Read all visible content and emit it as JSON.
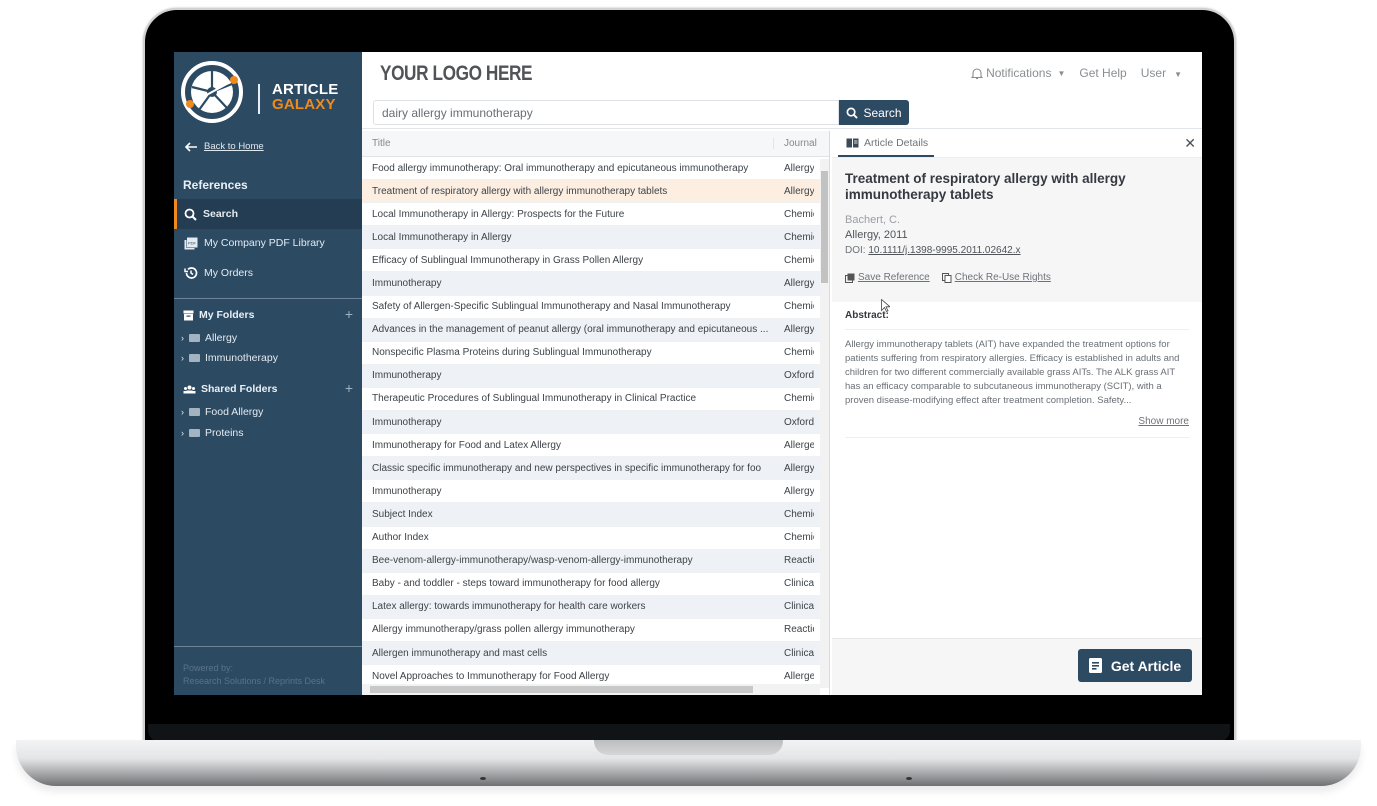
{
  "brand": {
    "line1": "ARTICLE",
    "line2": "GALAXY",
    "accent": "#f08a1c",
    "sidebar_bg": "#2d4a63"
  },
  "sidebar": {
    "back_label": "Back to Home",
    "section_title": "References",
    "nav": [
      {
        "label": "Search",
        "icon": "search-icon",
        "active": true
      },
      {
        "label": "My Company PDF Library",
        "icon": "pdf-icon",
        "active": false
      },
      {
        "label": "My Orders",
        "icon": "history-icon",
        "active": false
      }
    ],
    "my_folders": {
      "title": "My Folders",
      "items": [
        "Allergy",
        "Immunotherapy"
      ]
    },
    "shared_folders": {
      "title": "Shared Folders",
      "items": [
        "Food Allergy",
        "Proteins"
      ]
    },
    "powered_by": "Powered by:",
    "powered_by_company": "Research Solutions / Reprints Desk"
  },
  "header": {
    "logo_text": "YOUR LOGO HERE",
    "notifications": "Notifications",
    "help": "Get Help",
    "user": "User"
  },
  "search": {
    "value": "dairy allergy immunotherapy",
    "button": "Search"
  },
  "table": {
    "columns": [
      "Title",
      "Journal"
    ],
    "selected_index": 1,
    "rows": [
      {
        "title": "Food allergy immunotherapy: Oral immunotherapy and epicutaneous immunotherapy",
        "journal": "Allergy"
      },
      {
        "title": "Treatment of respiratory allergy with allergy immunotherapy tablets",
        "journal": "Allergy"
      },
      {
        "title": "Local Immunotherapy in Allergy: Prospects for the Future",
        "journal": "Chemic"
      },
      {
        "title": "Local Immunotherapy in Allergy",
        "journal": "Chemic"
      },
      {
        "title": "Efficacy of Sublingual Immunotherapy in Grass Pollen Allergy",
        "journal": "Chemic"
      },
      {
        "title": "Immunotherapy",
        "journal": "Allergy"
      },
      {
        "title": "Safety of Allergen-Specific Sublingual Immunotherapy and Nasal Immunotherapy",
        "journal": "Chemic"
      },
      {
        "title": "Advances in the management of peanut allergy (oral immunotherapy and epicutaneous ...",
        "journal": "Allergy"
      },
      {
        "title": "Nonspecific Plasma Proteins during Sublingual Immunotherapy",
        "journal": "Chemic"
      },
      {
        "title": "Immunotherapy",
        "journal": "Oxford"
      },
      {
        "title": "Therapeutic Procedures of Sublingual Immunotherapy in Clinical Practice",
        "journal": "Chemic"
      },
      {
        "title": "Immunotherapy",
        "journal": "Oxford"
      },
      {
        "title": "Immunotherapy for Food and Latex Allergy",
        "journal": "Allerger"
      },
      {
        "title": "Classic specific immunotherapy and new perspectives in specific immunotherapy for foo",
        "journal": "Allergy"
      },
      {
        "title": "Immunotherapy",
        "journal": "Allergy"
      },
      {
        "title": "Subject Index",
        "journal": "Chemic"
      },
      {
        "title": "Author Index",
        "journal": "Chemic"
      },
      {
        "title": "Bee-venom-allergy-immunotherapy/wasp-venom-allergy-immunotherapy",
        "journal": "Reactio"
      },
      {
        "title": "Baby - and toddler - steps toward immunotherapy for food allergy",
        "journal": "Clinical"
      },
      {
        "title": "Latex allergy: towards immunotherapy for health care workers",
        "journal": "Clinical"
      },
      {
        "title": "Allergy immunotherapy/grass pollen allergy immunotherapy",
        "journal": "Reactio"
      },
      {
        "title": "Allergen immunotherapy and mast cells",
        "journal": "Clinical"
      },
      {
        "title": "Novel Approaches to Immunotherapy for Food Allergy",
        "journal": "Allerger"
      }
    ]
  },
  "detail": {
    "tab": "Article Details",
    "title": "Treatment of respiratory allergy with allergy immunotherapy tablets",
    "author": "Bachert, C.",
    "journal_year": "Allergy, 2011",
    "doi_label": "DOI:",
    "doi": "10.1111/j.1398-9995.2011.02642.x",
    "save_reference": "Save Reference",
    "reuse_rights": "Check Re-Use Rights",
    "abstract_title": "Abstract:",
    "abstract": "Allergy immunotherapy tablets (AIT) have expanded the treatment options for patients suffering from respiratory allergies. Efficacy is established in adults and children for two different commercially available grass AITs. The ALK grass AIT has an efficacy comparable to subcutaneous immunotherapy (SCIT), with a proven disease-modifying effect after treatment completion. Safety...",
    "show_more": "Show more",
    "get_article": "Get Article"
  }
}
